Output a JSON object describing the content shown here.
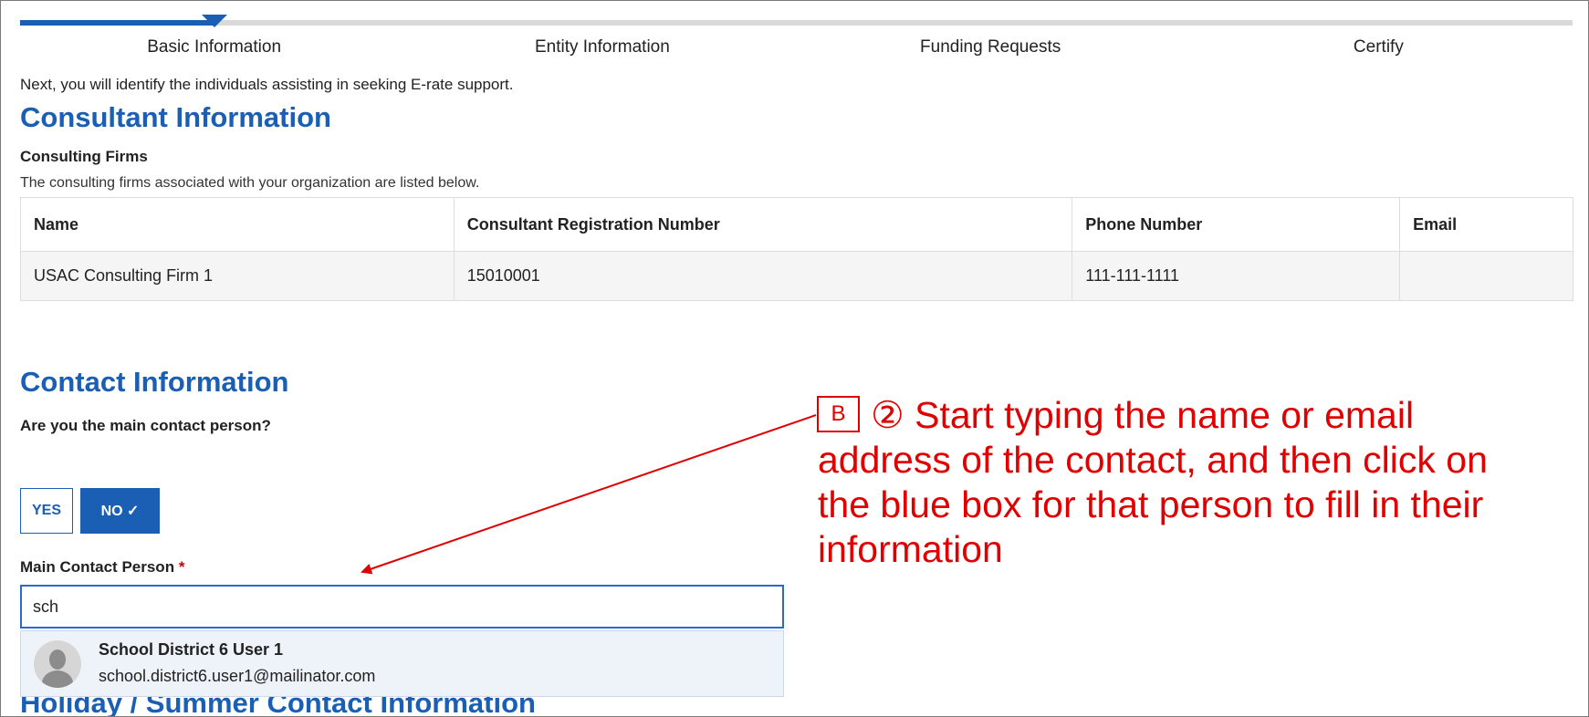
{
  "stepper": {
    "steps": [
      "Basic Information",
      "Entity Information",
      "Funding Requests",
      "Certify"
    ],
    "progress_fraction": 0.125
  },
  "intro_text": "Next, you will identify the individuals assisting in seeking E-rate support.",
  "consultant": {
    "heading": "Consultant Information",
    "subheading": "Consulting Firms",
    "description": "The consulting firms associated with your organization are listed below.",
    "table": {
      "columns": [
        "Name",
        "Consultant Registration Number",
        "Phone Number",
        "Email"
      ],
      "rows": [
        [
          "USAC Consulting Firm 1",
          "15010001",
          "111-111-1111",
          ""
        ]
      ]
    }
  },
  "contact": {
    "heading": "Contact Information",
    "question": "Are you the main contact person?",
    "yes_label": "YES",
    "no_label": "NO ✓",
    "selected": "NO",
    "main_contact_label": "Main Contact Person",
    "required_marker": "*",
    "input_value": "sch",
    "suggestion": {
      "name": "School District 6 User 1",
      "email": "school.district6.user1@mailinator.com"
    }
  },
  "holiday_heading": "Holiday / Summer Contact Information",
  "annotation": {
    "badge": "B",
    "text": "② Start typing the name or email address of the contact, and then click on the blue box for that person to fill in their information",
    "color": "#e00000"
  },
  "colors": {
    "accent": "#1a5fb4",
    "annotation": "#e00000"
  }
}
